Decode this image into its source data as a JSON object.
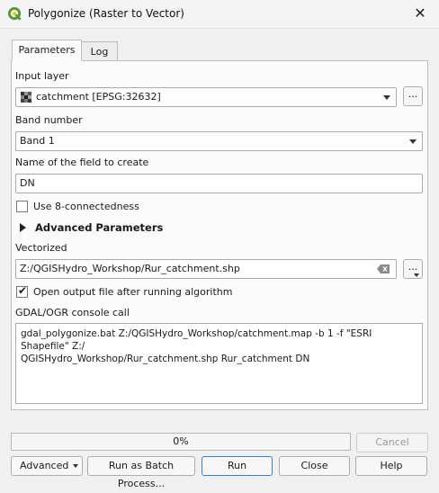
{
  "window": {
    "title": "Polygonize (Raster to Vector)",
    "close": "✕"
  },
  "tabs": [
    {
      "label": "Parameters",
      "active": true
    },
    {
      "label": "Log",
      "active": false
    }
  ],
  "form": {
    "input_layer_label": "Input layer",
    "input_layer_value": "catchment [EPSG:32632]",
    "band_number_label": "Band number",
    "band_number_value": "Band 1",
    "field_name_label": "Name of the field to create",
    "field_name_value": "DN",
    "use8_label": "Use 8-connectedness",
    "use8_checked": false,
    "advanced_label": "Advanced Parameters",
    "vectorized_label": "Vectorized",
    "vectorized_value": "Z:/QGISHydro_Workshop/Rur_catchment.shp",
    "open_output_label": "Open output file after running algorithm",
    "open_output_checked": true,
    "console_label": "GDAL/OGR console call",
    "console_line1": "gdal_polygonize.bat Z:/QGISHydro_Workshop/catchment.map -b 1 -f \"ESRI Shapefile\" Z:/",
    "console_line2": "QGISHydro_Workshop/Rur_catchment.shp Rur_catchment DN",
    "dots": "..."
  },
  "progress": {
    "value": 0,
    "label": "0%"
  },
  "buttons": {
    "cancel": "Cancel",
    "advanced": "Advanced",
    "batch": "Run as Batch Process...",
    "run": "Run",
    "close": "Close",
    "help": "Help"
  },
  "colors": {
    "qgis_green": "#589632",
    "qgis_yellow": "#f0c419",
    "run_border": "#3a7fd1"
  },
  "icons": [
    "qgis-logo-icon",
    "close-icon",
    "raster-layer-icon",
    "chevron-down-icon",
    "expand-triangle-icon",
    "clear-text-icon",
    "checkmark-icon"
  ]
}
